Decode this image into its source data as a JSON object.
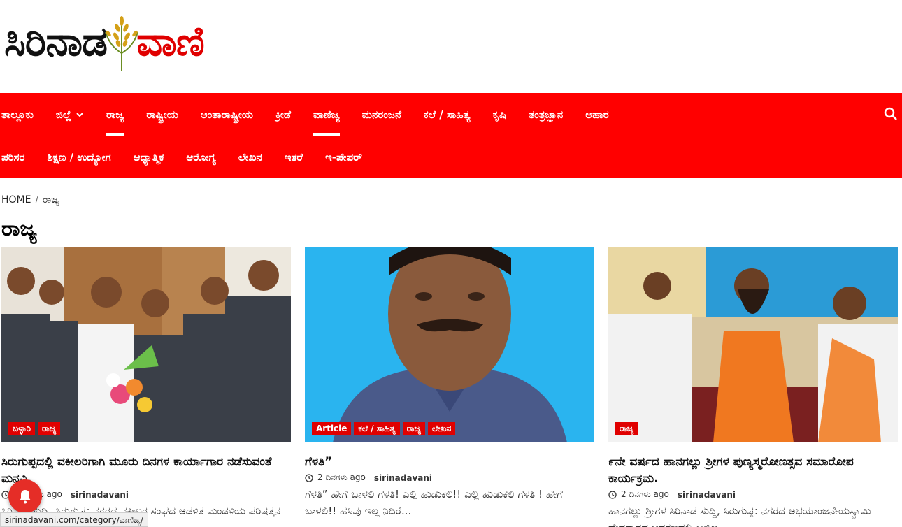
{
  "site": {
    "logo_left": "ಸಿರಿನಾಡ",
    "logo_right": "ವಾಣಿ",
    "brand_color": "#ff0000"
  },
  "nav": {
    "row1": [
      "ತಾಲ್ಲೂಕು",
      "ಜಿಲ್ಲೆ",
      "ರಾಜ್ಯ",
      "ರಾಷ್ಟ್ರೀಯ",
      "ಅಂತಾರಾಷ್ಟ್ರೀಯ",
      "ಕ್ರೀಡೆ",
      "ವಾಣಿಜ್ಯ",
      "ಮನರಂಜನೆ",
      "ಕಲೆ / ಸಾಹಿತ್ಯ",
      "ಕೃಷಿ",
      "ತಂತ್ರಜ್ಞಾನ",
      "ಆಹಾರ"
    ],
    "row2": [
      "ಪರಿಸರ",
      "ಶಿಕ್ಷಣ / ಉದ್ಯೋಗ",
      "ಆಧ್ಯಾತ್ಮಿಕ",
      "ಆರೋಗ್ಯ",
      "ಲೇಖನ",
      "ಇತರೆ",
      "ಇ-ಪೇಪರ್"
    ],
    "search_icon": "search-icon"
  },
  "breadcrumb": {
    "home": "HOME",
    "sep": "/",
    "current": "ರಾಜ್ಯ"
  },
  "page_title": "ರಾಜ್ಯ",
  "cards": [
    {
      "tags": [
        "ಬಳ್ಳಾರಿ",
        "ರಾಜ್ಯ"
      ],
      "title": "ಸಿರುಗುಪ್ಪದಲ್ಲಿ ವಕೀಲರಿಗಾಗಿ ಮೂರು ದಿನಗಳ ಕಾರ್ಯಾಗಾರ ನಡೆಸುವಂತೆ ಮನವಿ.",
      "time": "2 ದಿನಗಳು ago",
      "author": "sirinadavani",
      "excerpt": "ಸಿರಿನಾಡ ಸುದ್ದಿ, ಸಿರುಗುಪ್ಪ: ನಗರದ ವಕೀಲರ ಸಂಘದ ಆಡಳಿತ ಮಂಡಳಿಯ ಪರಿಷತ್ತನ ನೂತನ ಅಧ್ಯಕ್ಷರಾಗಿ"
    },
    {
      "tags": [
        "Article",
        "ಕಲೆ / ಸಾಹಿತ್ಯ",
        "ರಾಜ್ಯ",
        "ಲೇಖನ"
      ],
      "title": "ಗೆಳತಿ”",
      "time": "2 ದಿನಗಳು ago",
      "author": "sirinadavani",
      "excerpt": "ಗೆಳತಿ” ಹೇಗೆ ಬಾಳಲಿ ಗೆಳತಿ! ಎಲ್ಲಿ ಹುಡುಕಲಿ!! ಎಲ್ಲಿ ಹುಡುಕಲಿ ಗೆಳತಿ ! ಹೇಗೆ ಬಾಳಲಿ!! ಹಸಿವು ಇಲ್ಲ ನಿದಿರೆ..."
    },
    {
      "tags": [
        "ರಾಜ್ಯ"
      ],
      "title": "೯ನೇ ವರ್ಷದ ಹಾನಗಲ್ಲು ಶ್ರೀಗಳ ಪುಣ್ಯಸ್ಮರೋಣತ್ಸವ ಸಮಾರೋಪ ಕಾರ್ಯಕ್ರಮ.",
      "time": "2 ದಿನಗಳು ago",
      "author": "sirinadavani",
      "excerpt": "ಹಾನಗಲ್ಲು ಶ್ರೀಗಳ ಸಿರಿನಾಡ ಸುದ್ದಿ, ಸಿರುಗುಪ್ಪ: ನಗರದ ಅಭಯಾಂಜನೇಯಸ್ವಾಮಿ ದೇವಸ್ಥಾನದ ಆವರಣದಲ್ಲಿ ಅಖಿಲ"
    }
  ],
  "status_url": "sirinadavani.com/category/ವಾಣಿಜ್ಯ/"
}
